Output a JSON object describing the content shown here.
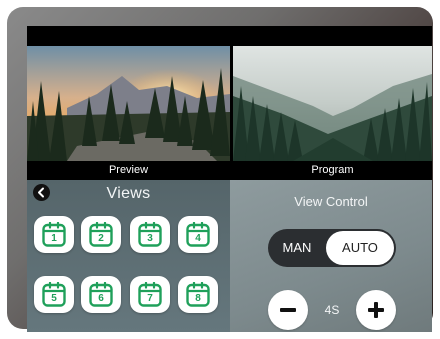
{
  "monitors": {
    "preview_label": "Preview",
    "program_label": "Program"
  },
  "views": {
    "title": "Views",
    "buttons": [
      "1",
      "2",
      "3",
      "4",
      "5",
      "6",
      "7",
      "8"
    ]
  },
  "view_control": {
    "title": "View Control",
    "mode_options": [
      "MAN",
      "AUTO"
    ],
    "selected_mode": "AUTO",
    "interval": "4S"
  },
  "colors": {
    "accent_green": "#1fa05a",
    "toggle_dark": "#2b2e31"
  },
  "icons": {
    "back": "chevron-left-circle-icon",
    "view": "calendar-icon",
    "decrease": "minus-icon",
    "increase": "plus-icon"
  }
}
